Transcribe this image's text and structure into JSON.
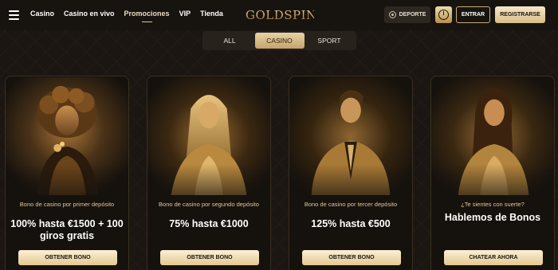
{
  "nav": {
    "items": [
      {
        "label": "Casino"
      },
      {
        "label": "Casino en vivo"
      },
      {
        "label": "Promociones"
      },
      {
        "label": "VIP"
      },
      {
        "label": "Tienda"
      }
    ],
    "active": "Promociones"
  },
  "brand": {
    "logo": "GOLDSPIN"
  },
  "header": {
    "deporte_label": "DEPORTE",
    "login_label": "ENTRAR",
    "register_label": "REGISTRARSE"
  },
  "tabs": [
    {
      "label": "ALL"
    },
    {
      "label": "CASINO"
    },
    {
      "label": "SPORT"
    }
  ],
  "active_tab": "CASINO",
  "cards": [
    {
      "subtitle": "Bono de casino por primer depósito",
      "headline": "100% hasta €1500 + 100 giros gratis",
      "cta": "OBTENER BONO"
    },
    {
      "subtitle": "Bono de casino por segundo depósito",
      "headline": "75% hasta €1000",
      "cta": "OBTENER BONO"
    },
    {
      "subtitle": "Bono de casino por tercer depósito",
      "headline": "125% hasta €500",
      "cta": "OBTENER BONO"
    },
    {
      "subtitle": "¿Te sientes con suerte?",
      "headline": "Hablemos de Bonos",
      "cta": "CHATEAR AHORA"
    }
  ],
  "colors": {
    "background": "#1a1510",
    "accent_gold": "#d8bd88",
    "subtitle_gold": "#e2c996"
  }
}
